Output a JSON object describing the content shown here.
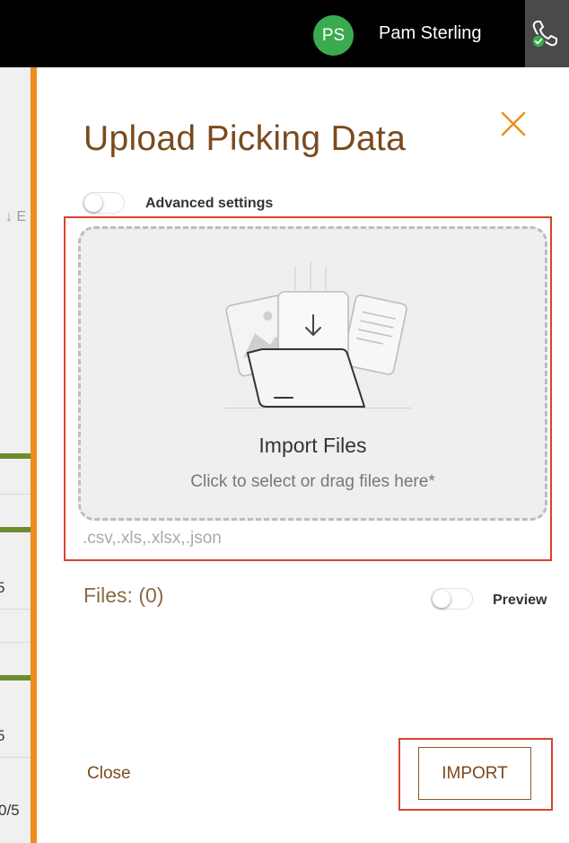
{
  "topbar": {
    "avatar_initials": "PS",
    "user_name": "Pam Sterling",
    "phone_icon": "phone-connected-icon"
  },
  "background_page": {
    "fragments": [
      "↓ E",
      "5",
      "5",
      "0/5"
    ]
  },
  "panel": {
    "title": "Upload Picking Data",
    "close_icon": "close-icon",
    "advanced_settings_label": "Advanced settings",
    "advanced_settings_enabled": false,
    "dropzone": {
      "title": "Import Files",
      "subtitle": "Click to select or drag files here*",
      "illustration_icon": "upload-folder-illustration-icon"
    },
    "accepted_types": ".csv,.xls,.xlsx,.json",
    "files_count_label": "Files: (0)",
    "preview_label": "Preview",
    "preview_enabled": false,
    "close_button_label": "Close",
    "import_button_label": "IMPORT"
  },
  "colors": {
    "accent_orange": "#ef8b1b",
    "brown_text": "#7a4a1e",
    "highlight_red": "#d9432f",
    "avatar_green": "#3aaa4f"
  }
}
